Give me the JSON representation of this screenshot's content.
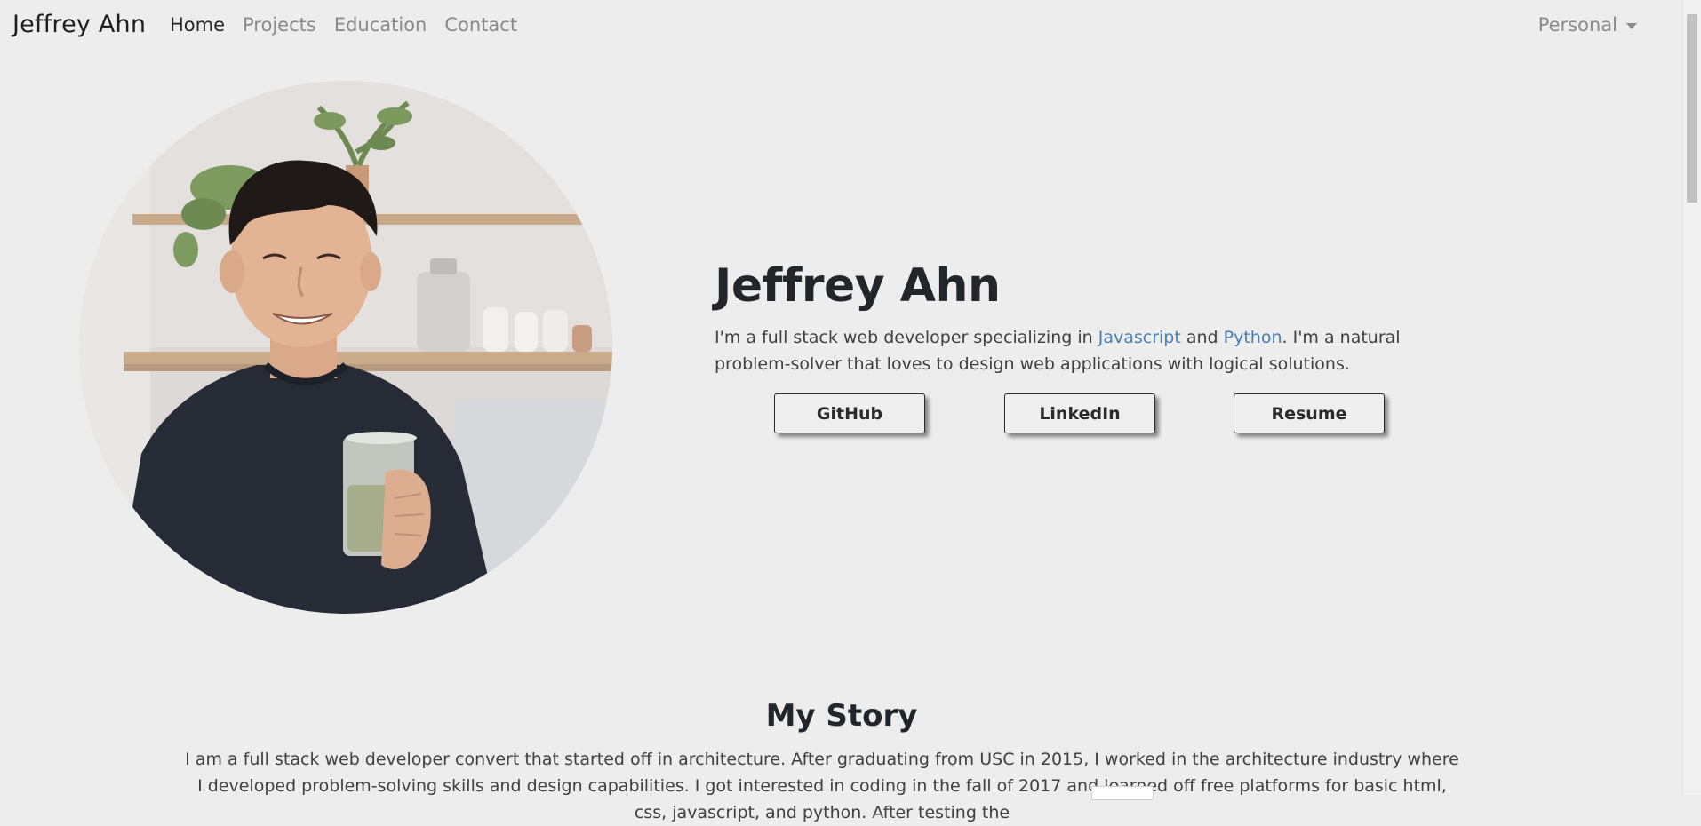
{
  "nav": {
    "brand": "Jeffrey Ahn",
    "links": [
      "Home",
      "Projects",
      "Education",
      "Contact"
    ],
    "active": "Home",
    "dropdown_label": "Personal"
  },
  "hero": {
    "name": "Jeffrey Ahn",
    "bio_prefix": "I'm a full stack web developer specializing in ",
    "bio_lang1": "Javascript",
    "bio_mid": " and ",
    "bio_lang2": "Python",
    "bio_suffix": ". I'm a natural problem-solver that loves to design web applications with logical solutions.",
    "buttons": {
      "github": "GitHub",
      "linkedin": "LinkedIn",
      "resume": "Resume"
    }
  },
  "story": {
    "title": "My Story",
    "text": "I am a full stack web developer convert that started off in architecture. After graduating from USC in 2015, I worked in the architecture industry where I developed problem-solving skills and design capabilities. I got interested in coding in the fall of 2017 and learned off free platforms for basic html, css, javascript, and python. After testing the"
  },
  "colors": {
    "background": "#eeeded",
    "link_highlight": "#4a7fb5",
    "heading": "#22262b"
  }
}
